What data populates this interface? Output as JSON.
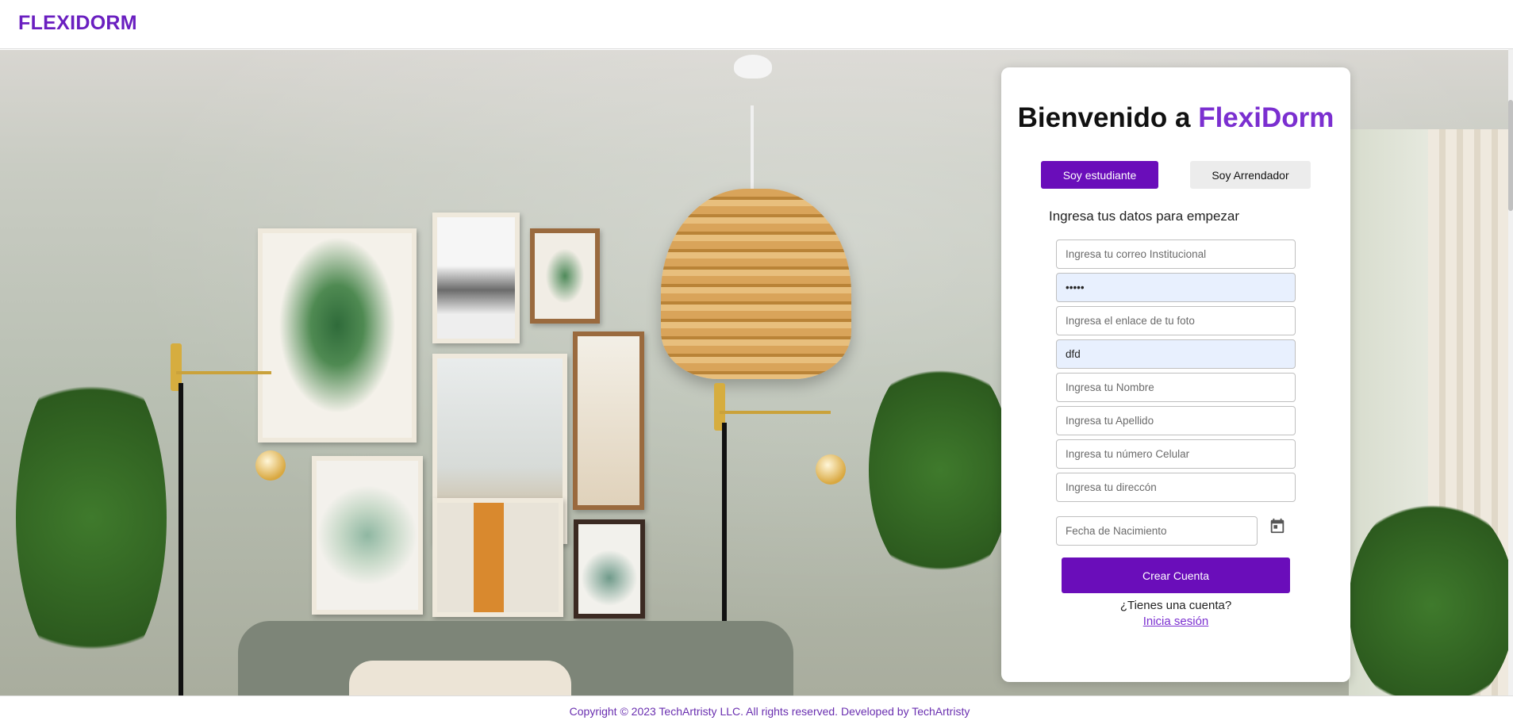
{
  "header": {
    "logo": "FLEXIDORM"
  },
  "card": {
    "welcome_prefix": "Bienvenido a ",
    "welcome_brand": "FlexiDorm",
    "tabs": {
      "student": "Soy estudiante",
      "landlord": "Soy Arrendador"
    },
    "subtitle": "Ingresa tus datos para empezar",
    "fields": {
      "email": {
        "placeholder": "Ingresa tu correo Institucional",
        "value": ""
      },
      "password": {
        "placeholder": "",
        "value": "•••••"
      },
      "photo": {
        "placeholder": "Ingresa el enlace de tu foto",
        "value": ""
      },
      "dfd": {
        "placeholder": "",
        "value": "dfd"
      },
      "first_name": {
        "placeholder": "Ingresa tu Nombre",
        "value": ""
      },
      "last_name": {
        "placeholder": "Ingresa tu Apellido",
        "value": ""
      },
      "phone": {
        "placeholder": "Ingresa tu número Celular",
        "value": ""
      },
      "address": {
        "placeholder": "Ingresa tu direccón",
        "value": ""
      },
      "birthdate": {
        "placeholder": "Fecha de Nacimiento",
        "value": ""
      }
    },
    "submit_label": "Crear Cuenta",
    "have_account": "¿Tienes una cuenta?",
    "login_link": "Inicia sesión"
  },
  "footer": {
    "text": "Copyright © 2023 TechArtristy LLC. All rights reserved. Developed by TechArtristy"
  },
  "icons": {
    "calendar": "calendar-icon"
  },
  "colors": {
    "brand": "#6a0dba",
    "brand_text": "#7b2fd0",
    "footer_text": "#6a2fb0",
    "autofill_bg": "#e8f0fe"
  }
}
